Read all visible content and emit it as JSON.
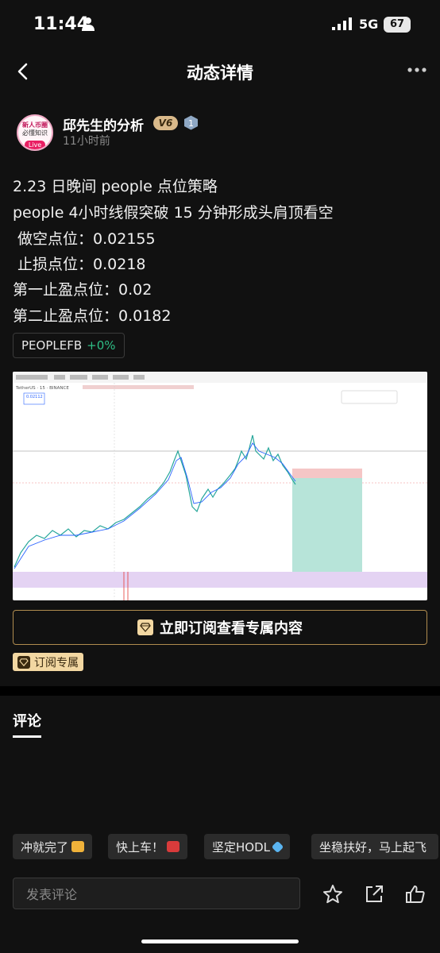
{
  "status_bar": {
    "time": "11:44",
    "network": "5G",
    "battery": "67"
  },
  "nav": {
    "title": "动态详情"
  },
  "author": {
    "avatar_line1": "新人币圈",
    "avatar_line2": "必懂知识",
    "avatar_live": "Live",
    "name": "邱先生的分析",
    "vip_badge": "V6",
    "level": "1",
    "time_ago": "11小时前"
  },
  "post": {
    "lines": [
      "2.23 日晚间 people 点位策略",
      "people 4小时线假突破 15 分钟形成头肩顶看空",
      " 做空点位：0.02155",
      " 止损点位：0.0218",
      "第一止盈点位：0.02",
      "第二止盈点位：0.0182"
    ],
    "tag": {
      "symbol": "PEOPLEFB",
      "change": "+0%",
      "change_color": "#2ebd85"
    }
  },
  "chart_image": {
    "header_pair": "TetherUS · 15 · BINANCE",
    "price_label": "0.02112",
    "colors": {
      "up": "#26a69a",
      "down": "#ef5350",
      "stop_zone": "#f5c6c6",
      "target_zone": "#b7e4d9",
      "volume_band": "#e4d3f3"
    }
  },
  "subscribe": {
    "button_label": "立即订阅查看专属内容",
    "badge_label": "订阅专属",
    "accent": "#f2d7a2"
  },
  "comments": {
    "title": "评论"
  },
  "quick_replies": [
    {
      "label": "冲就完了",
      "emoji": "flexed-biceps"
    },
    {
      "label": "快上车！",
      "emoji": "red-car"
    },
    {
      "label": "坚定HODL",
      "emoji": "gem"
    },
    {
      "label": "坐稳扶好，马上起飞",
      "emoji": ""
    }
  ],
  "footer": {
    "input_placeholder": "发表评论"
  }
}
